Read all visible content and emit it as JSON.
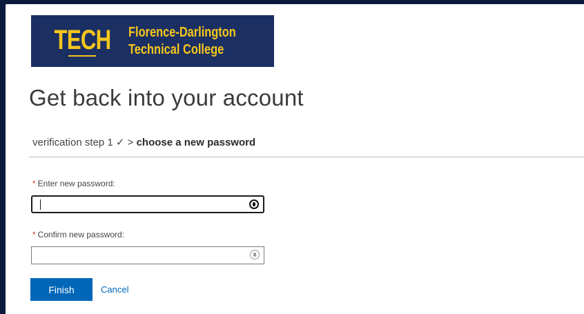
{
  "brand": {
    "mark": "TECH",
    "name_line1": "Florence-Darlington",
    "name_line2": "Technical College",
    "colors": {
      "background": "#1b2f63",
      "gold": "#f6c61b"
    }
  },
  "page": {
    "title": "Get back into your account"
  },
  "steps": {
    "completed": "verification step 1 ✓",
    "separator": ">",
    "current": "choose a new password"
  },
  "form": {
    "required_marker": "*",
    "new_password": {
      "label": "Enter new password:",
      "value": "",
      "icon": "password-reveal-icon"
    },
    "confirm_password": {
      "label": "Confirm new password:",
      "value": "",
      "icon": "password-reveal-icon"
    }
  },
  "actions": {
    "finish_label": "Finish",
    "cancel_label": "Cancel",
    "accent_color": "#0067b8"
  }
}
